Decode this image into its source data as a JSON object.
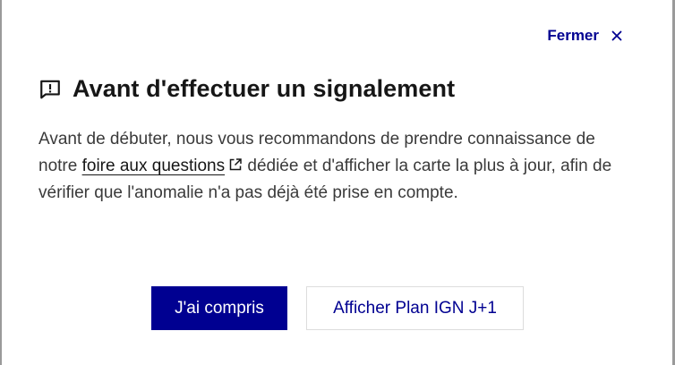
{
  "dialog": {
    "close_label": "Fermer",
    "title": "Avant d'effectuer un signalement",
    "body": {
      "before_link": "Avant de débuter, nous vous recommandons de prendre connaissance de notre ",
      "link_text": "foire aux questions",
      "after_link": " dédiée et d'afficher la carte la plus à jour, afin de vérifier que l'anomalie n'a pas déjà été prise en compte."
    },
    "primary_button": "J'ai compris",
    "secondary_button": "Afficher Plan IGN J+1"
  },
  "icons": {
    "title_icon": "feedback-alert-icon",
    "close_icon": "close-icon",
    "link_icon": "external-link-icon"
  },
  "colors": {
    "primary": "#000091",
    "text": "#161616",
    "body_text": "#3a3a3a",
    "border": "#dddddd"
  }
}
